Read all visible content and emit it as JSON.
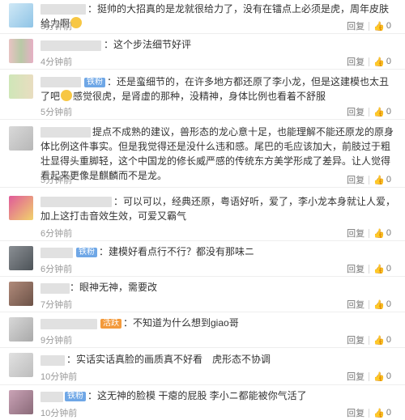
{
  "comments": [
    {
      "badge": "",
      "text": "：挺帅的大招真的是龙就很给力了，没有在镭点上必须是虎，周年皮肤给力啊",
      "time": "3分钟前",
      "reply": "回复",
      "likes": "0"
    },
    {
      "badge": "",
      "text": "：这个步法细节好评",
      "time": "4分钟前",
      "reply": "回复",
      "likes": "0"
    },
    {
      "badge": "铁粉",
      "text": "：还是蛮细节的，在许多地方都还原了李小龙，但是这建模也太丑了吧",
      "text2": "感觉很虎，是肾虚的那种，没精神，身体比例也看着不舒服",
      "time": "5分钟前",
      "reply": "回复",
      "likes": "0"
    },
    {
      "badge": "",
      "text": "提点不成熟的建议，兽形态的龙心意十足，也能理解不能还原龙的原身体比例这件事实。但是我觉得还是没什么违和感。尾巴的毛应该加大，前肢过于粗壮显得头重脚轻，这个中国龙的修长威严感的传统东方美学形成了差异。让人觉得看起来更像是麒麟而不是龙。",
      "time": "5分钟前",
      "reply": "回复",
      "likes": "0"
    },
    {
      "badge": "",
      "text": "：可以可以，经典还原，粤语好听，爱了，李小龙本身就让人爱，加上这打击音效生效，可爱又霸气",
      "time": "6分钟前",
      "reply": "回复",
      "likes": "0"
    },
    {
      "badge": "铁粉",
      "text": "：建模好看点行不行？都没有那味ニ",
      "time": "6分钟前",
      "reply": "回复",
      "likes": "0"
    },
    {
      "badge": "",
      "text": "：眼神无神，需要改",
      "time": "7分钟前",
      "reply": "回复",
      "likes": "0"
    },
    {
      "badge": "活跃",
      "text": "：不知道为什么想到giao哥",
      "time": "9分钟前",
      "reply": "回复",
      "likes": "0"
    },
    {
      "badge": "",
      "text": "：实话实话真脸的画质真不好看　虎形态不协调",
      "time": "10分钟前",
      "reply": "回复",
      "likes": "0"
    },
    {
      "badge": "铁粉",
      "text": "：这无神的脸模 干瘪的屁股 李小ニ都能被你气活了",
      "time": "10分钟前",
      "reply": "回复",
      "likes": "0"
    }
  ]
}
